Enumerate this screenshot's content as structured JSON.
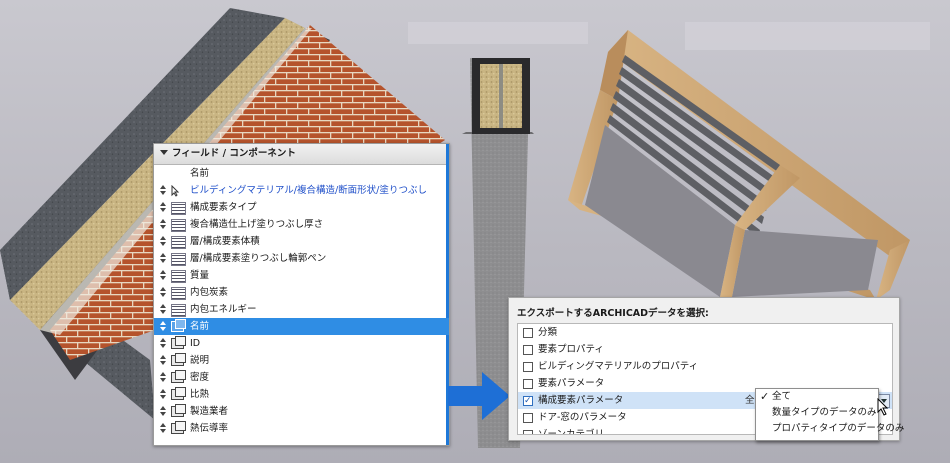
{
  "left_panel": {
    "header": "フィールド / コンポーネント",
    "rows": [
      {
        "label": "名前",
        "icon": "none",
        "handle": false,
        "style": "plain"
      },
      {
        "label": "ビルディングマテリアル/複合構造/断面形状/塗りつぶし",
        "icon": "cursor-icon",
        "handle": true,
        "style": "blue"
      },
      {
        "label": "構成要素タイプ",
        "icon": "hatch-icon",
        "handle": true,
        "style": "plain"
      },
      {
        "label": "複合構造仕上げ塗りつぶし厚さ",
        "icon": "hatch-icon",
        "handle": true,
        "style": "plain"
      },
      {
        "label": "層/構成要素体積",
        "icon": "hatch-icon",
        "handle": true,
        "style": "plain"
      },
      {
        "label": "層/構成要素塗りつぶし輪郭ペン",
        "icon": "hatch-icon",
        "handle": true,
        "style": "plain"
      },
      {
        "label": "質量",
        "icon": "hatch-icon",
        "handle": true,
        "style": "plain"
      },
      {
        "label": "内包炭素",
        "icon": "hatch-icon",
        "handle": true,
        "style": "plain"
      },
      {
        "label": "内包エネルギー",
        "icon": "hatch-icon",
        "handle": true,
        "style": "plain"
      },
      {
        "label": "名前",
        "icon": "cube-icon",
        "handle": true,
        "style": "selected"
      },
      {
        "label": "ID",
        "icon": "cube-icon",
        "handle": true,
        "style": "plain"
      },
      {
        "label": "説明",
        "icon": "cube-icon",
        "handle": true,
        "style": "plain"
      },
      {
        "label": "密度",
        "icon": "cube-icon",
        "handle": true,
        "style": "plain"
      },
      {
        "label": "比熱",
        "icon": "cube-icon",
        "handle": true,
        "style": "plain"
      },
      {
        "label": "製造業者",
        "icon": "cube-icon",
        "handle": true,
        "style": "plain"
      },
      {
        "label": "熱伝導率",
        "icon": "cube-icon",
        "handle": true,
        "style": "plain"
      }
    ]
  },
  "right_panel": {
    "title": "エクスポートするARCHICADデータを選択:",
    "rows": [
      {
        "label": "分類",
        "checked": false,
        "selected": false
      },
      {
        "label": "要素プロパティ",
        "checked": false,
        "selected": false
      },
      {
        "label": "ビルディングマテリアルのプロパティ",
        "checked": false,
        "selected": false
      },
      {
        "label": "要素パラメータ",
        "checked": false,
        "selected": false
      },
      {
        "label": "構成要素パラメータ",
        "checked": true,
        "selected": true,
        "side_value": "全て"
      },
      {
        "label": "ドア-窓のパラメータ",
        "checked": false,
        "selected": false
      },
      {
        "label": "ゾーンカテゴリ",
        "checked": false,
        "selected": false
      }
    ]
  },
  "dropdown": {
    "options": [
      {
        "label": "全て",
        "checked": true
      },
      {
        "label": "数量タイプのデータのみ",
        "checked": false
      },
      {
        "label": "プロパティタイプのデータのみ",
        "checked": false
      }
    ]
  },
  "colors": {
    "selection_blue": "#2f8de4",
    "arrow_blue": "#1e6fd6",
    "link_blue": "#1f4fc9"
  }
}
